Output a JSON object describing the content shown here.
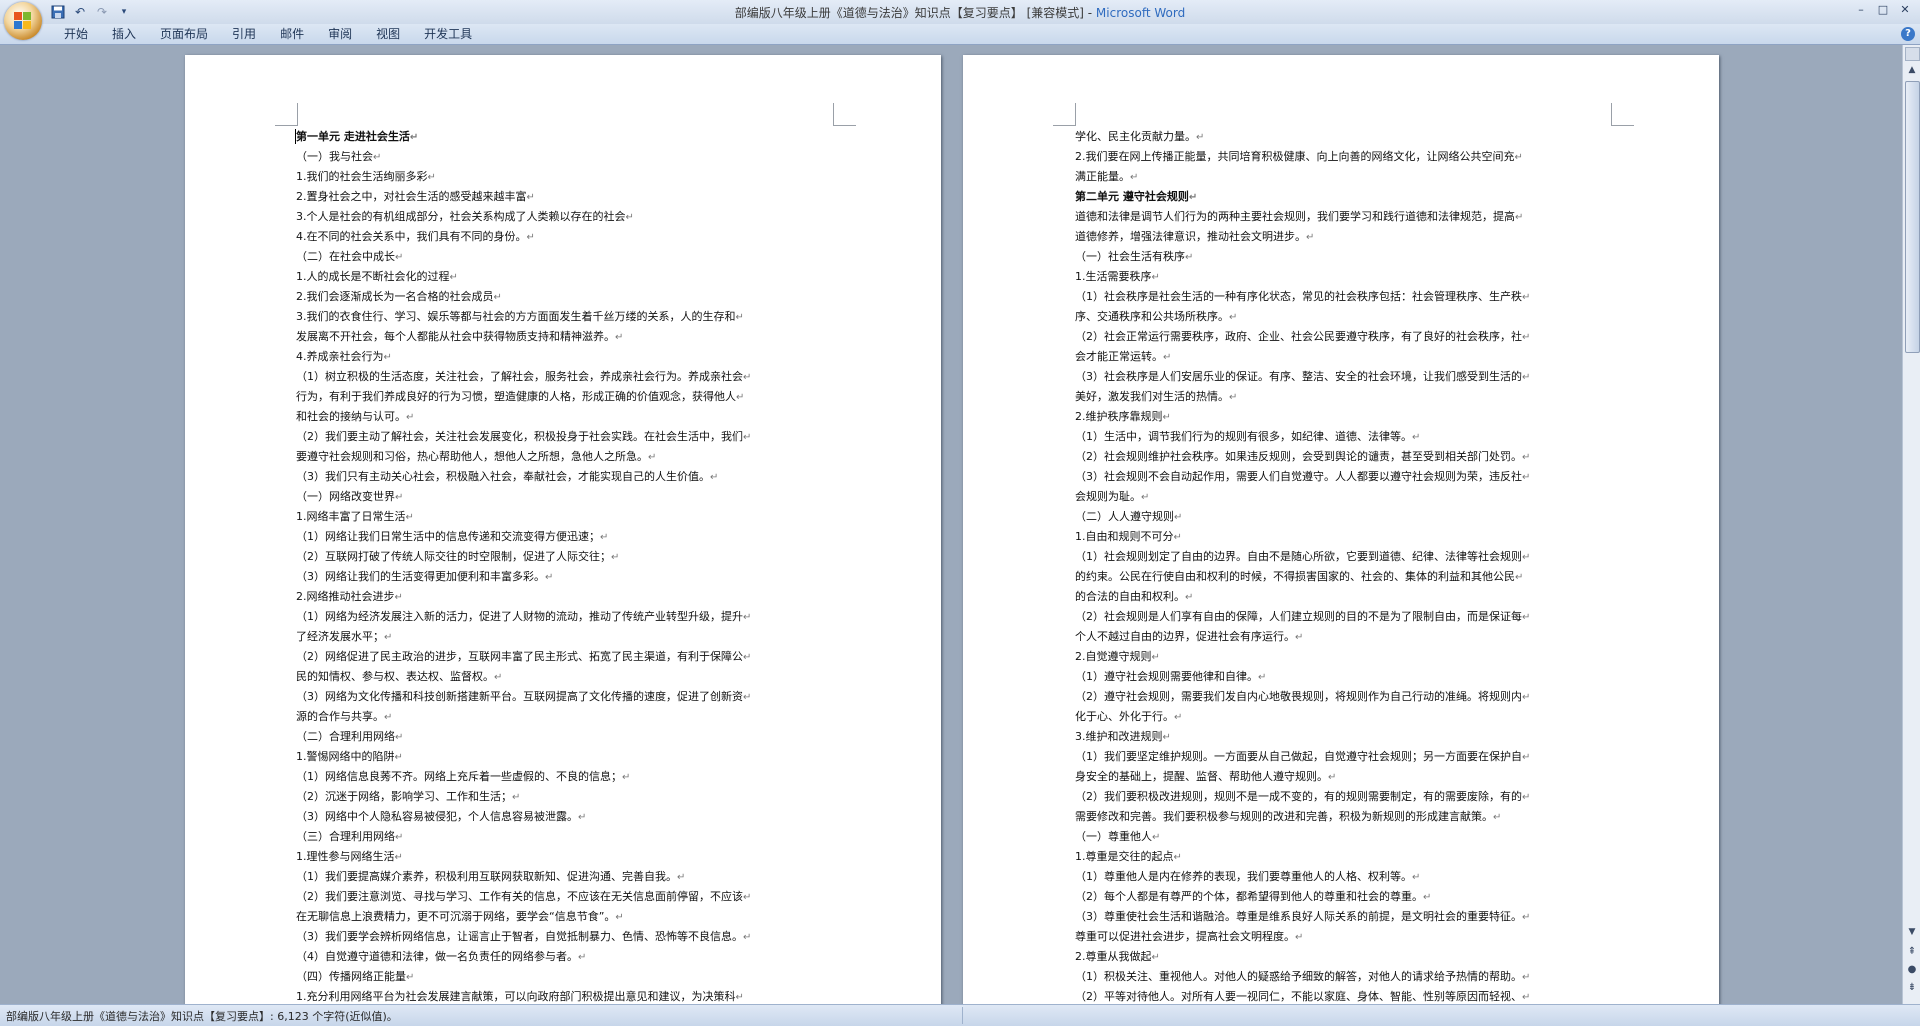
{
  "window": {
    "title": "部编版八年级上册《道德与法治》知识点【复习要点】 [兼容模式] - ",
    "app_name": "Microsoft Word",
    "controls": {
      "minimize": "–",
      "maximize": "□",
      "close": "✕"
    }
  },
  "qat": {
    "save_icon": "floppy-disk-icon",
    "undo_symbol": "↶",
    "redo_symbol": "↷",
    "customize_symbol": "▾"
  },
  "ribbon": {
    "tabs": [
      "开始",
      "插入",
      "页面布局",
      "引用",
      "邮件",
      "审阅",
      "视图",
      "开发工具"
    ],
    "help": "?"
  },
  "pages": [
    {
      "lines": [
        {
          "t": "第一单元  走进社会生活",
          "h": true
        },
        {
          "t": "（一）我与社会"
        },
        {
          "t": "1.我们的社会生活绚丽多彩"
        },
        {
          "t": "2.置身社会之中，对社会生活的感受越来越丰富"
        },
        {
          "t": "3.个人是社会的有机组成部分，社会关系构成了人类赖以存在的社会"
        },
        {
          "t": "4.在不同的社会关系中，我们具有不同的身份。"
        },
        {
          "t": "（二）在社会中成长"
        },
        {
          "t": "1.人的成长是不断社会化的过程"
        },
        {
          "t": "2.我们会逐渐成长为一名合格的社会成员"
        },
        {
          "t": "3.我们的衣食住行、学习、娱乐等都与社会的方方面面发生着千丝万缕的关系，人的生存和"
        },
        {
          "t": "发展离不开社会，每个人都能从社会中获得物质支持和精神滋养。"
        },
        {
          "t": "4.养成亲社会行为"
        },
        {
          "t": "（1）树立积极的生活态度，关注社会，了解社会，服务社会，养成亲社会行为。养成亲社会"
        },
        {
          "t": "行为，有利于我们养成良好的行为习惯，塑造健康的人格，形成正确的价值观念，获得他人"
        },
        {
          "t": "和社会的接纳与认可。"
        },
        {
          "t": "（2）我们要主动了解社会，关注社会发展变化，积极投身于社会实践。在社会生活中，我们"
        },
        {
          "t": "要遵守社会规则和习俗，热心帮助他人，想他人之所想，急他人之所急。"
        },
        {
          "t": "（3）我们只有主动关心社会，积极融入社会，奉献社会，才能实现自己的人生价值。"
        },
        {
          "t": "（一）网络改变世界"
        },
        {
          "t": "1.网络丰富了日常生活"
        },
        {
          "t": "（1）网络让我们日常生活中的信息传递和交流变得方便迅速；"
        },
        {
          "t": "（2）互联网打破了传统人际交往的时空限制，促进了人际交往；"
        },
        {
          "t": "（3）网络让我们的生活变得更加便利和丰富多彩。"
        },
        {
          "t": "2.网络推动社会进步"
        },
        {
          "t": "（1）网络为经济发展注入新的活力，促进了人财物的流动，推动了传统产业转型升级，提升"
        },
        {
          "t": "了经济发展水平；"
        },
        {
          "t": "（2）网络促进了民主政治的进步，互联网丰富了民主形式、拓宽了民主渠道，有利于保障公"
        },
        {
          "t": "民的知情权、参与权、表达权、监督权。"
        },
        {
          "t": "（3）网络为文化传播和科技创新搭建新平台。互联网提高了文化传播的速度，促进了创新资"
        },
        {
          "t": "源的合作与共享。"
        },
        {
          "t": "（二）合理利用网络"
        },
        {
          "t": "1.警惕网络中的陷阱"
        },
        {
          "t": "（1）网络信息良莠不齐。网络上充斥着一些虚假的、不良的信息；"
        },
        {
          "t": "（2）沉迷于网络，影响学习、工作和生活；"
        },
        {
          "t": "（3）网络中个人隐私容易被侵犯，个人信息容易被泄露。"
        },
        {
          "t": "（三）合理利用网络"
        },
        {
          "t": "1.理性参与网络生活"
        },
        {
          "t": "（1）我们要提高媒介素养，积极利用互联网获取新知、促进沟通、完善自我。"
        },
        {
          "t": "（2）我们要注意浏览、寻找与学习、工作有关的信息，不应该在无关信息面前停留，不应该"
        },
        {
          "t": "在无聊信息上浪费精力，更不可沉溺于网络，要学会“信息节食”。"
        },
        {
          "t": "（3）我们要学会辨析网络信息，让谣言止于智者，自觉抵制暴力、色情、恐怖等不良信息。"
        },
        {
          "t": "（4）自觉遵守道德和法律，做一名负责任的网络参与者。"
        },
        {
          "t": "（四）传播网络正能量"
        },
        {
          "t": "1.充分利用网络平台为社会发展建言献策，可以向政府部门积极提出意见和建议，为决策科"
        }
      ]
    },
    {
      "lines": [
        {
          "t": "学化、民主化贡献力量。"
        },
        {
          "t": "2.我们要在网上传播正能量，共同培育积极健康、向上向善的网络文化，让网络公共空间充"
        },
        {
          "t": "满正能量。"
        },
        {
          "t": "第二单元  遵守社会规则",
          "h": true
        },
        {
          "t": "道德和法律是调节人们行为的两种主要社会规则，我们要学习和践行道德和法律规范，提高"
        },
        {
          "t": "道德修养，增强法律意识，推动社会文明进步。"
        },
        {
          "t": "（一）社会生活有秩序"
        },
        {
          "t": "1.生活需要秩序"
        },
        {
          "t": "（1）社会秩序是社会生活的一种有序化状态，常见的社会秩序包括：社会管理秩序、生产秩"
        },
        {
          "t": "序、交通秩序和公共场所秩序。"
        },
        {
          "t": "（2）社会正常运行需要秩序，政府、企业、社会公民要遵守秩序，有了良好的社会秩序，社"
        },
        {
          "t": "会才能正常运转。"
        },
        {
          "t": "（3）社会秩序是人们安居乐业的保证。有序、整洁、安全的社会环境，让我们感受到生活的"
        },
        {
          "t": "美好，激发我们对生活的热情。"
        },
        {
          "t": "2.维护秩序靠规则"
        },
        {
          "t": "（1）生活中，调节我们行为的规则有很多，如纪律、道德、法律等。"
        },
        {
          "t": "（2）社会规则维护社会秩序。如果违反规则，会受到舆论的谴责，甚至受到相关部门处罚。"
        },
        {
          "t": "（3）社会规则不会自动起作用，需要人们自觉遵守。人人都要以遵守社会规则为荣，违反社"
        },
        {
          "t": "会规则为耻。"
        },
        {
          "t": "（二）人人遵守规则"
        },
        {
          "t": "1.自由和规则不可分"
        },
        {
          "t": "（1）社会规则划定了自由的边界。自由不是随心所欲，它要到道德、纪律、法律等社会规则"
        },
        {
          "t": "的约束。公民在行使自由和权利的时候，不得损害国家的、社会的、集体的利益和其他公民"
        },
        {
          "t": "的合法的自由和权利。"
        },
        {
          "t": "（2）社会规则是人们享有自由的保障，人们建立规则的目的不是为了限制自由，而是保证每"
        },
        {
          "t": "个人不越过自由的边界，促进社会有序运行。"
        },
        {
          "t": "2.自觉遵守规则"
        },
        {
          "t": "（1）遵守社会规则需要他律和自律。"
        },
        {
          "t": "（2）遵守社会规则，需要我们发自内心地敬畏规则，将规则作为自己行动的准绳。将规则内"
        },
        {
          "t": "化于心、外化于行。"
        },
        {
          "t": "3.维护和改进规则"
        },
        {
          "t": "（1）我们要坚定维护规则。一方面要从自己做起，自觉遵守社会规则；另一方面要在保护自"
        },
        {
          "t": "身安全的基础上，提醒、监督、帮助他人遵守规则。"
        },
        {
          "t": "（2）我们要积极改进规则，规则不是一成不变的，有的规则需要制定，有的需要废除，有的"
        },
        {
          "t": "需要修改和完善。我们要积极参与规则的改进和完善，积极为新规则的形成建言献策。"
        },
        {
          "t": "（一）尊重他人"
        },
        {
          "t": "1.尊重是交往的起点"
        },
        {
          "t": "（1）尊重他人是内在修养的表现，我们要尊重他人的人格、权利等。"
        },
        {
          "t": "（2）每个人都是有尊严的个体，都希望得到他人的尊重和社会的尊重。"
        },
        {
          "t": "（3）尊重使社会生活和谐融洽。尊重是维系良好人际关系的前提，是文明社会的重要特征。"
        },
        {
          "t": "尊重可以促进社会进步，提高社会文明程度。"
        },
        {
          "t": "2.尊重从我做起"
        },
        {
          "t": "（1）积极关注、重视他人。对他人的疑惑给予细致的解答，对他人的请求给予热情的帮助。"
        },
        {
          "t": "（2）平等对待他人。对所有人要一视同仁，不能以家庭、身体、智能、性别等原因而轻视、"
        }
      ]
    }
  ],
  "paragraph_mark": "↵",
  "scrollbar": {
    "up": "▲",
    "down": "▼",
    "prev_page": "⇞",
    "select_browse": "●",
    "next_page": "⇟"
  },
  "status_bar": {
    "text": "部编版八年级上册《道德与法治》知识点【复习要点】: 6,123 个字符(近似值)。"
  },
  "colors": {
    "title_app": "#2f6bbf",
    "doc_background": "#9ba9bb",
    "ribbon": "#dde7f4"
  }
}
